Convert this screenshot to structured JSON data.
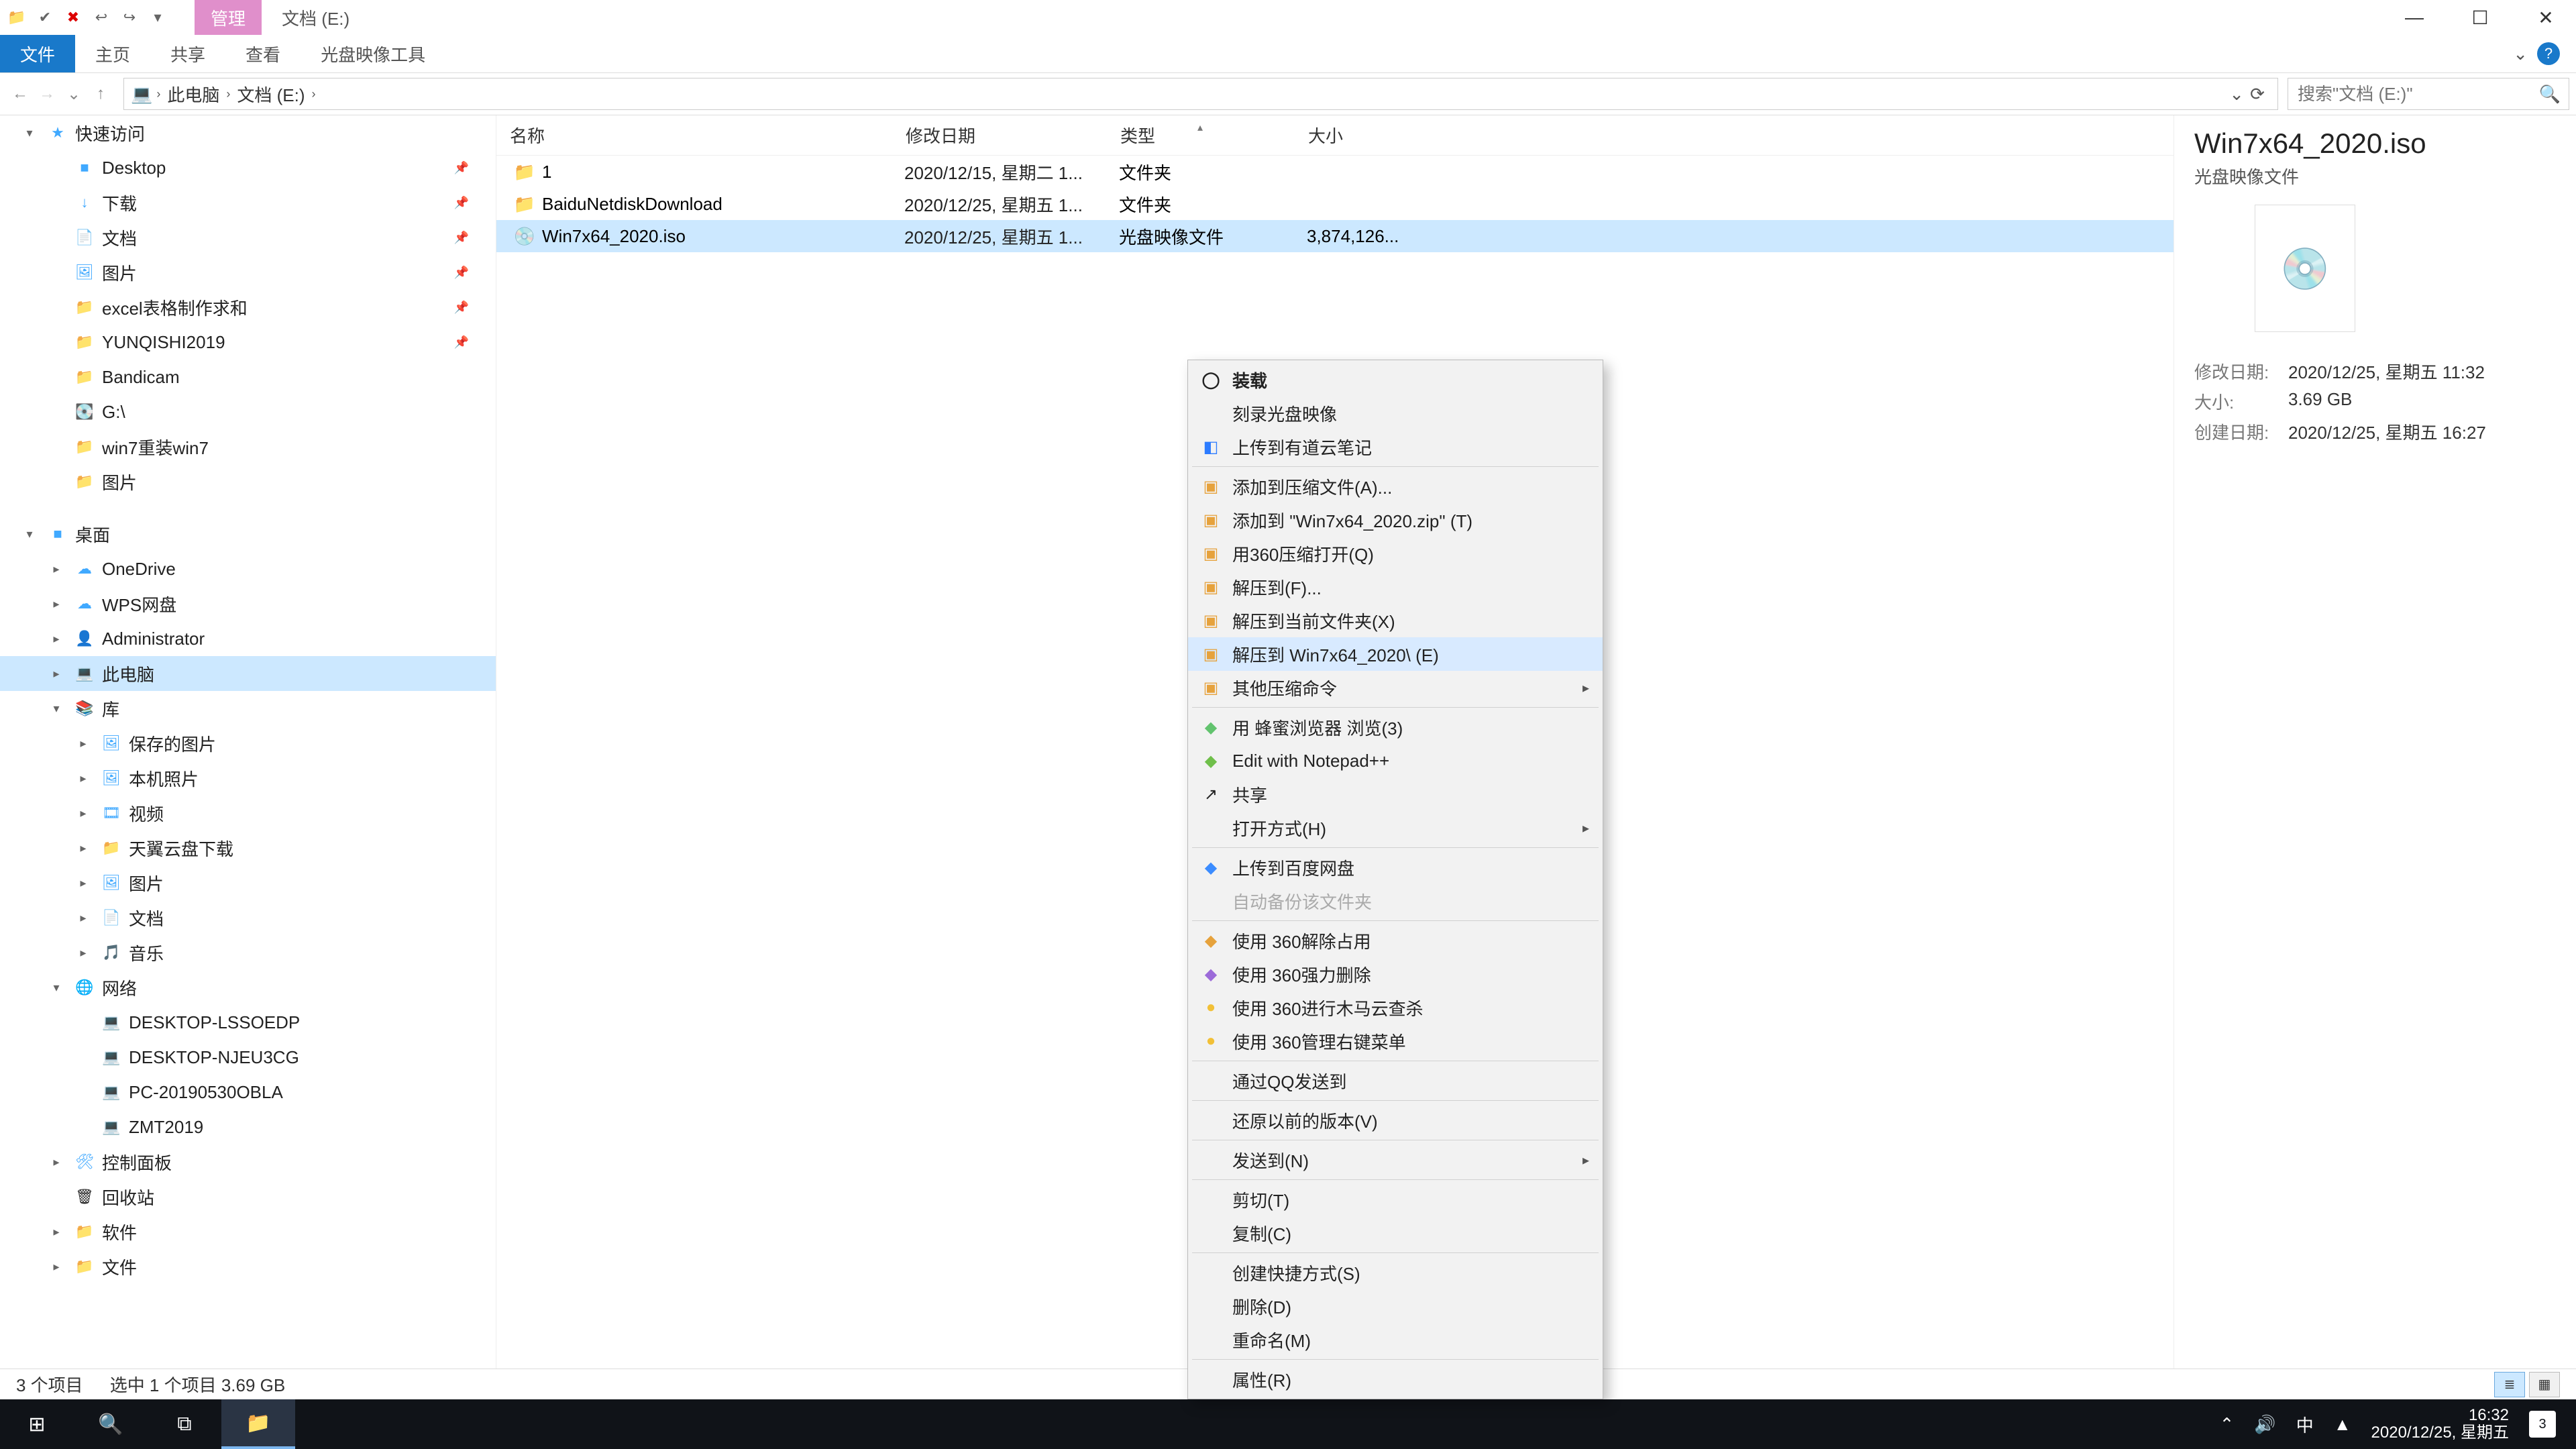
{
  "win": {
    "title": "文档 (E:)",
    "tool_tab": "管理",
    "tool_group": "光盘映像工具"
  },
  "ribbon": {
    "file": "文件",
    "home": "主页",
    "share": "共享",
    "view": "查看"
  },
  "addr": {
    "root": "此电脑",
    "folder": "文档 (E:)",
    "search_placeholder": "搜索\"文档 (E:)\""
  },
  "nav": [
    {
      "label": "快速访问",
      "depth": 1,
      "icon": "★",
      "cls": "ci-blue",
      "caret": "▾"
    },
    {
      "label": "Desktop",
      "depth": 2,
      "icon": "■",
      "cls": "ci-blue",
      "pin": true
    },
    {
      "label": "下载",
      "depth": 2,
      "icon": "↓",
      "cls": "ci-blue",
      "pin": true
    },
    {
      "label": "文档",
      "depth": 2,
      "icon": "📄",
      "cls": "ci-blue",
      "pin": true
    },
    {
      "label": "图片",
      "depth": 2,
      "icon": "🖼",
      "cls": "ci-blue",
      "pin": true
    },
    {
      "label": "excel表格制作求和",
      "depth": 2,
      "icon": "📁",
      "cls": "ci-yellow",
      "pin": true
    },
    {
      "label": "YUNQISHI2019",
      "depth": 2,
      "icon": "📁",
      "cls": "ci-yellow",
      "pin": true
    },
    {
      "label": "Bandicam",
      "depth": 2,
      "icon": "📁",
      "cls": "ci-yellow"
    },
    {
      "label": "G:\\",
      "depth": 2,
      "icon": "💽",
      "cls": ""
    },
    {
      "label": "win7重装win7",
      "depth": 2,
      "icon": "📁",
      "cls": "ci-yellow"
    },
    {
      "label": "图片",
      "depth": 2,
      "icon": "📁",
      "cls": "ci-yellow"
    },
    {
      "label": " ",
      "spacer": true
    },
    {
      "label": "桌面",
      "depth": 1,
      "icon": "■",
      "cls": "ci-blue",
      "caret": "▾"
    },
    {
      "label": "OneDrive",
      "depth": 2,
      "icon": "☁",
      "cls": "ci-blue",
      "caret": "▸"
    },
    {
      "label": "WPS网盘",
      "depth": 2,
      "icon": "☁",
      "cls": "ci-blue",
      "caret": "▸"
    },
    {
      "label": "Administrator",
      "depth": 2,
      "icon": "👤",
      "cls": "",
      "caret": "▸"
    },
    {
      "label": "此电脑",
      "depth": 2,
      "icon": "💻",
      "cls": "",
      "sel": true,
      "caret": "▸"
    },
    {
      "label": "库",
      "depth": 2,
      "icon": "📚",
      "cls": "ci-blue",
      "caret": "▾"
    },
    {
      "label": "保存的图片",
      "depth": 3,
      "icon": "🖼",
      "cls": "ci-blue",
      "caret": "▸"
    },
    {
      "label": "本机照片",
      "depth": 3,
      "icon": "🖼",
      "cls": "ci-blue",
      "caret": "▸"
    },
    {
      "label": "视频",
      "depth": 3,
      "icon": "🎞",
      "cls": "ci-blue",
      "caret": "▸"
    },
    {
      "label": "天翼云盘下载",
      "depth": 3,
      "icon": "📁",
      "cls": "ci-blue",
      "caret": "▸"
    },
    {
      "label": "图片",
      "depth": 3,
      "icon": "🖼",
      "cls": "ci-blue",
      "caret": "▸"
    },
    {
      "label": "文档",
      "depth": 3,
      "icon": "📄",
      "cls": "ci-blue",
      "caret": "▸"
    },
    {
      "label": "音乐",
      "depth": 3,
      "icon": "🎵",
      "cls": "ci-blue",
      "caret": "▸"
    },
    {
      "label": "网络",
      "depth": 2,
      "icon": "🌐",
      "cls": "ci-blue",
      "caret": "▾"
    },
    {
      "label": "DESKTOP-LSSOEDP",
      "depth": 3,
      "icon": "💻",
      "cls": ""
    },
    {
      "label": "DESKTOP-NJEU3CG",
      "depth": 3,
      "icon": "💻",
      "cls": ""
    },
    {
      "label": "PC-20190530OBLA",
      "depth": 3,
      "icon": "💻",
      "cls": ""
    },
    {
      "label": "ZMT2019",
      "depth": 3,
      "icon": "💻",
      "cls": ""
    },
    {
      "label": "控制面板",
      "depth": 2,
      "icon": "🛠",
      "cls": "ci-blue",
      "caret": "▸"
    },
    {
      "label": "回收站",
      "depth": 2,
      "icon": "🗑",
      "cls": ""
    },
    {
      "label": "软件",
      "depth": 2,
      "icon": "📁",
      "cls": "ci-yellow",
      "caret": "▸"
    },
    {
      "label": "文件",
      "depth": 2,
      "icon": "📁",
      "cls": "ci-yellow",
      "caret": "▸"
    }
  ],
  "cols": {
    "name": "名称",
    "date": "修改日期",
    "type": "类型",
    "size": "大小"
  },
  "rows": [
    {
      "name": "1",
      "date": "2020/12/15, 星期二 1...",
      "type": "文件夹",
      "size": "",
      "icon": "folder"
    },
    {
      "name": "BaiduNetdiskDownload",
      "date": "2020/12/25, 星期五 1...",
      "type": "文件夹",
      "size": "",
      "icon": "folder"
    },
    {
      "name": "Win7x64_2020.iso",
      "date": "2020/12/25, 星期五 1...",
      "type": "光盘映像文件",
      "size": "3,874,126...",
      "icon": "iso",
      "sel": true
    }
  ],
  "preview": {
    "name": "Win7x64_2020.iso",
    "type": "光盘映像文件",
    "m_label": "修改日期:",
    "m_val": "2020/12/25, 星期五 11:32",
    "s_label": "大小:",
    "s_val": "3.69 GB",
    "c_label": "创建日期:",
    "c_val": "2020/12/25, 星期五 16:27"
  },
  "ctx": [
    {
      "label": "装载",
      "icon": "◯",
      "bold": true
    },
    {
      "label": "刻录光盘映像"
    },
    {
      "label": "上传到有道云笔记",
      "icon": "◧",
      "iconcolor": "#2d7cff"
    },
    {
      "sep": true
    },
    {
      "label": "添加到压缩文件(A)...",
      "icon": "▣",
      "iconcolor": "#e6a23c"
    },
    {
      "label": "添加到 \"Win7x64_2020.zip\" (T)",
      "icon": "▣",
      "iconcolor": "#e6a23c"
    },
    {
      "label": "用360压缩打开(Q)",
      "icon": "▣",
      "iconcolor": "#e6a23c"
    },
    {
      "label": "解压到(F)...",
      "icon": "▣",
      "iconcolor": "#e6a23c"
    },
    {
      "label": "解压到当前文件夹(X)",
      "icon": "▣",
      "iconcolor": "#e6a23c"
    },
    {
      "label": "解压到 Win7x64_2020\\ (E)",
      "icon": "▣",
      "iconcolor": "#e6a23c",
      "hover": true
    },
    {
      "label": "其他压缩命令",
      "icon": "▣",
      "iconcolor": "#e6a23c",
      "sub": true
    },
    {
      "sep": true
    },
    {
      "label": "用 蜂蜜浏览器 浏览(3)",
      "icon": "◆",
      "iconcolor": "#62c36e"
    },
    {
      "label": "Edit with Notepad++",
      "icon": "◆",
      "iconcolor": "#6fbf4a"
    },
    {
      "label": "共享",
      "icon": "↗"
    },
    {
      "label": "打开方式(H)",
      "sub": true
    },
    {
      "sep": true
    },
    {
      "label": "上传到百度网盘",
      "icon": "◆",
      "iconcolor": "#3b8cff"
    },
    {
      "label": "自动备份该文件夹",
      "disabled": true
    },
    {
      "sep": true
    },
    {
      "label": "使用 360解除占用",
      "icon": "◆",
      "iconcolor": "#e6a23c"
    },
    {
      "label": "使用 360强力删除",
      "icon": "◆",
      "iconcolor": "#9c6bd9"
    },
    {
      "label": "使用 360进行木马云查杀",
      "icon": "●",
      "iconcolor": "#f2c037"
    },
    {
      "label": "使用 360管理右键菜单",
      "icon": "●",
      "iconcolor": "#f2c037"
    },
    {
      "sep": true
    },
    {
      "label": "通过QQ发送到"
    },
    {
      "sep": true
    },
    {
      "label": "还原以前的版本(V)"
    },
    {
      "sep": true
    },
    {
      "label": "发送到(N)",
      "sub": true
    },
    {
      "sep": true
    },
    {
      "label": "剪切(T)"
    },
    {
      "label": "复制(C)"
    },
    {
      "sep": true
    },
    {
      "label": "创建快捷方式(S)"
    },
    {
      "label": "删除(D)"
    },
    {
      "label": "重命名(M)"
    },
    {
      "sep": true
    },
    {
      "label": "属性(R)"
    }
  ],
  "status": {
    "count": "3 个项目",
    "sel": "选中 1 个项目  3.69 GB"
  },
  "taskbar": {
    "time": "16:32",
    "date": "2020/12/25, 星期五",
    "badge": "3",
    "ime": "中"
  }
}
